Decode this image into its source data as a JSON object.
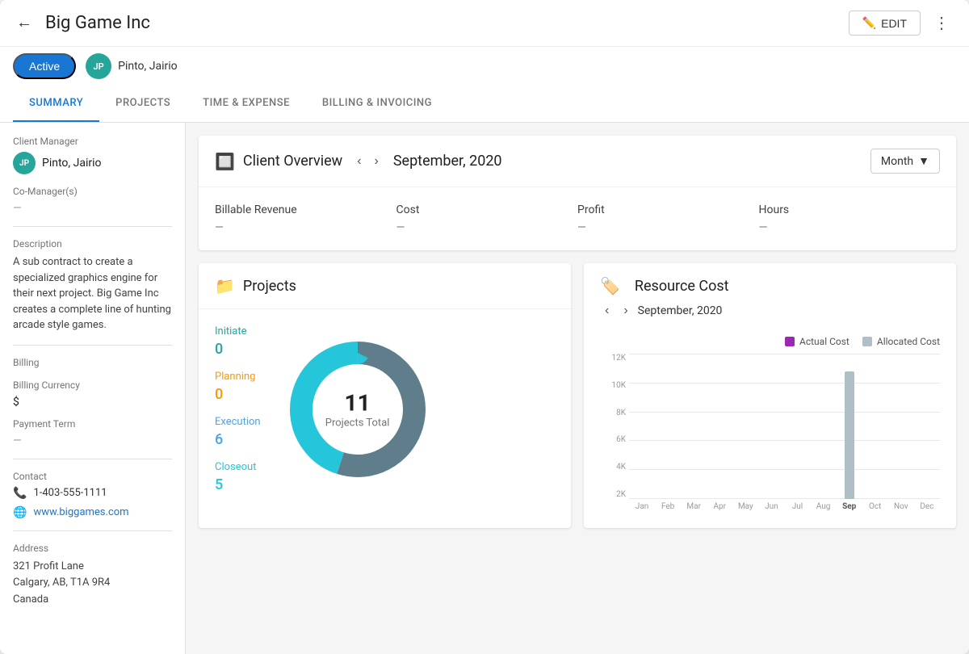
{
  "header": {
    "back_label": "←",
    "title": "Big Game Inc",
    "edit_label": "EDIT",
    "more_label": "⋮"
  },
  "status": {
    "active_label": "Active",
    "manager_initials": "JP",
    "manager_name": "Pinto, Jairio"
  },
  "tabs": [
    {
      "id": "summary",
      "label": "SUMMARY",
      "active": true
    },
    {
      "id": "projects",
      "label": "PROJECTS",
      "active": false
    },
    {
      "id": "time-expense",
      "label": "TIME & EXPENSE",
      "active": false
    },
    {
      "id": "billing",
      "label": "BILLING & INVOICING",
      "active": false
    }
  ],
  "sidebar": {
    "client_manager_label": "Client Manager",
    "manager_initials": "JP",
    "manager_name": "Pinto, Jairio",
    "co_manager_label": "Co-Manager(s)",
    "co_manager_value": "—",
    "description_label": "Description",
    "description_text": "A sub contract to create a specialized graphics engine for their next project. Big Game Inc creates a complete line of hunting arcade style games.",
    "billing_label": "Billing",
    "billing_currency_label": "Billing Currency",
    "billing_currency_value": "$",
    "payment_term_label": "Payment Term",
    "payment_term_value": "—",
    "contact_label": "Contact",
    "phone": "1-403-555-1111",
    "website": "www.biggames.com",
    "address_label": "Address",
    "address_line1": "321 Profit Lane",
    "address_line2": "Calgary, AB, T1A 9R4",
    "address_line3": "Canada"
  },
  "overview": {
    "title": "Client Overview",
    "period": "September, 2020",
    "period_dropdown": "Month",
    "billable_revenue_label": "Billable Revenue",
    "billable_revenue_value": "—",
    "cost_label": "Cost",
    "cost_value": "—",
    "profit_label": "Profit",
    "profit_value": "—",
    "hours_label": "Hours",
    "hours_value": "—"
  },
  "projects": {
    "title": "Projects",
    "initiate_label": "Initiate",
    "initiate_value": "0",
    "planning_label": "Planning",
    "planning_value": "0",
    "execution_label": "Execution",
    "execution_value": "6",
    "closeout_label": "Closeout",
    "closeout_value": "5",
    "donut_total": "11",
    "donut_text": "Projects Total"
  },
  "resource_cost": {
    "title": "Resource Cost",
    "period": "September, 2020",
    "legend_actual": "Actual Cost",
    "legend_allocated": "Allocated Cost",
    "y_labels": [
      "2K",
      "4K",
      "6K",
      "8K",
      "10K",
      "12K"
    ],
    "x_labels": [
      "Jan",
      "Feb",
      "Mar",
      "Apr",
      "May",
      "Jun",
      "Jul",
      "Aug",
      "Sep",
      "Oct",
      "Nov",
      "Dec"
    ],
    "bars": [
      {
        "month": "Jan",
        "actual": 0,
        "allocated": 0
      },
      {
        "month": "Feb",
        "actual": 0,
        "allocated": 0
      },
      {
        "month": "Mar",
        "actual": 0,
        "allocated": 0
      },
      {
        "month": "Apr",
        "actual": 0,
        "allocated": 0
      },
      {
        "month": "May",
        "actual": 0,
        "allocated": 0
      },
      {
        "month": "Jun",
        "actual": 0,
        "allocated": 0
      },
      {
        "month": "Jul",
        "actual": 0,
        "allocated": 0
      },
      {
        "month": "Aug",
        "actual": 0,
        "allocated": 0
      },
      {
        "month": "Sep",
        "actual": 0,
        "allocated": 88
      },
      {
        "month": "Oct",
        "actual": 0,
        "allocated": 0
      },
      {
        "month": "Nov",
        "actual": 0,
        "allocated": 0
      },
      {
        "month": "Dec",
        "actual": 0,
        "allocated": 0
      }
    ]
  }
}
